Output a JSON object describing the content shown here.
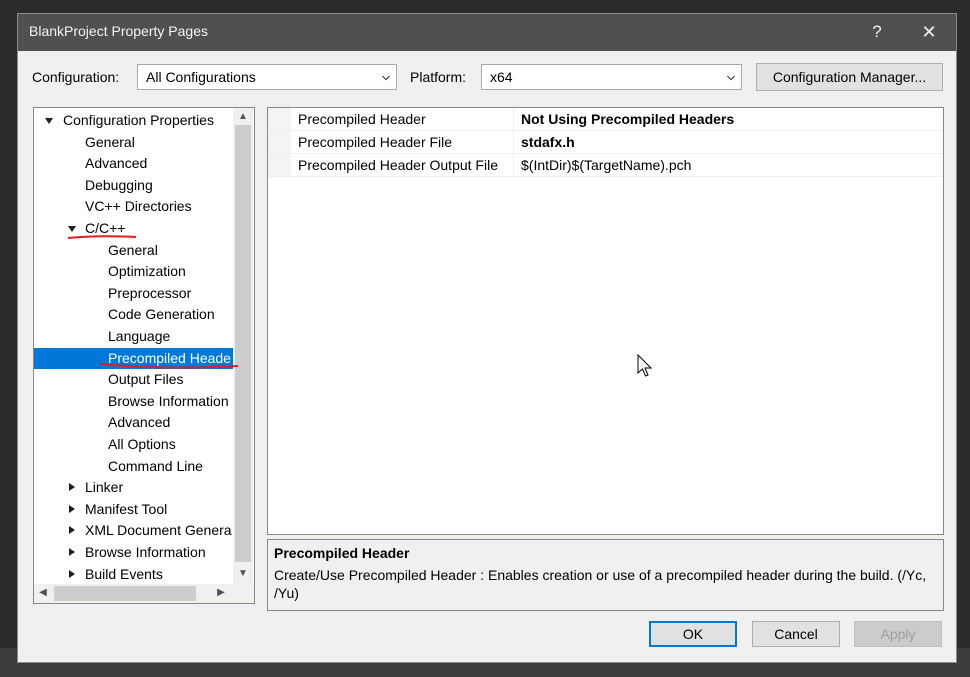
{
  "window": {
    "title": "BlankProject Property Pages",
    "help_label": "?",
    "close_label": "✕"
  },
  "toolbar": {
    "configuration_label": "Configuration:",
    "configuration_value": "All Configurations",
    "platform_label": "Platform:",
    "platform_value": "x64",
    "config_manager_label": "Configuration Manager..."
  },
  "tree": {
    "items": [
      {
        "label": "Configuration Properties",
        "level": 0,
        "expander": "expanded"
      },
      {
        "label": "General",
        "level": 1,
        "expander": "none"
      },
      {
        "label": "Advanced",
        "level": 1,
        "expander": "none"
      },
      {
        "label": "Debugging",
        "level": 1,
        "expander": "none"
      },
      {
        "label": "VC++ Directories",
        "level": 1,
        "expander": "none"
      },
      {
        "label": "C/C++",
        "level": 1,
        "expander": "expanded"
      },
      {
        "label": "General",
        "level": 2,
        "expander": "none"
      },
      {
        "label": "Optimization",
        "level": 2,
        "expander": "none"
      },
      {
        "label": "Preprocessor",
        "level": 2,
        "expander": "none"
      },
      {
        "label": "Code Generation",
        "level": 2,
        "expander": "none"
      },
      {
        "label": "Language",
        "level": 2,
        "expander": "none"
      },
      {
        "label": "Precompiled Heade",
        "level": 2,
        "expander": "none",
        "selected": true
      },
      {
        "label": "Output Files",
        "level": 2,
        "expander": "none"
      },
      {
        "label": "Browse Information",
        "level": 2,
        "expander": "none"
      },
      {
        "label": "Advanced",
        "level": 2,
        "expander": "none"
      },
      {
        "label": "All Options",
        "level": 2,
        "expander": "none"
      },
      {
        "label": "Command Line",
        "level": 2,
        "expander": "none"
      },
      {
        "label": "Linker",
        "level": 1,
        "expander": "collapsed"
      },
      {
        "label": "Manifest Tool",
        "level": 1,
        "expander": "collapsed"
      },
      {
        "label": "XML Document Genera",
        "level": 1,
        "expander": "collapsed"
      },
      {
        "label": "Browse Information",
        "level": 1,
        "expander": "collapsed"
      },
      {
        "label": "Build Events",
        "level": 1,
        "expander": "collapsed"
      }
    ]
  },
  "properties": [
    {
      "name": "Precompiled Header",
      "value": "Not Using Precompiled Headers",
      "bold": true
    },
    {
      "name": "Precompiled Header File",
      "value": "stdafx.h",
      "bold": true
    },
    {
      "name": "Precompiled Header Output File",
      "value": "$(IntDir)$(TargetName).pch",
      "bold": false
    }
  ],
  "description": {
    "title": "Precompiled Header",
    "text": "Create/Use Precompiled Header : Enables creation or use of a precompiled header during the build. (/Yc, /Yu)"
  },
  "buttons": {
    "ok": "OK",
    "cancel": "Cancel",
    "apply": "Apply"
  },
  "colors": {
    "selection": "#0078d7",
    "annotation_red": "#e02020",
    "titlebar": "#505050"
  }
}
